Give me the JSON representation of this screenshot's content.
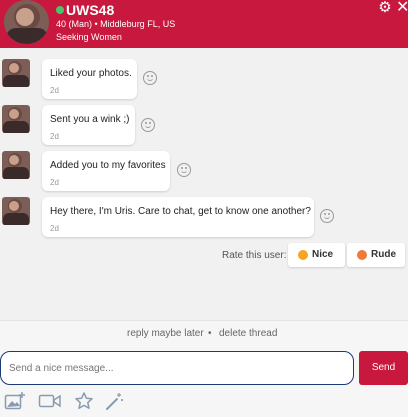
{
  "profile": {
    "username": "UWS48",
    "details": "40 (Man) • Middleburg FL, US",
    "seeking": "Seeking Women",
    "online": true
  },
  "header_icons": [
    "gear-icon",
    "close-icon"
  ],
  "messages": [
    {
      "text": "Liked your photos.",
      "time": "2d"
    },
    {
      "text": "Sent you a wink ;)",
      "time": "2d"
    },
    {
      "text": "Added you to my favorites",
      "time": "2d"
    },
    {
      "text": "Hey there, I'm Uris. Care to chat, get to know one another?",
      "time": "2d"
    }
  ],
  "rating": {
    "label": "Rate this user:",
    "nice_label": "Nice",
    "rude_label": "Rude"
  },
  "actions": {
    "reply_later": "reply maybe later",
    "separator": "•",
    "delete_thread": "delete thread"
  },
  "composer": {
    "placeholder": "Send a nice message...",
    "send_label": "Send"
  },
  "toolbar_icons": [
    "add-photo-icon",
    "video-icon",
    "star-icon",
    "magic-wand-icon"
  ],
  "colors": {
    "brand": "#c8183d",
    "background": "#f1f1f1",
    "input_border": "#1a3a7a",
    "online": "#48c46a"
  }
}
